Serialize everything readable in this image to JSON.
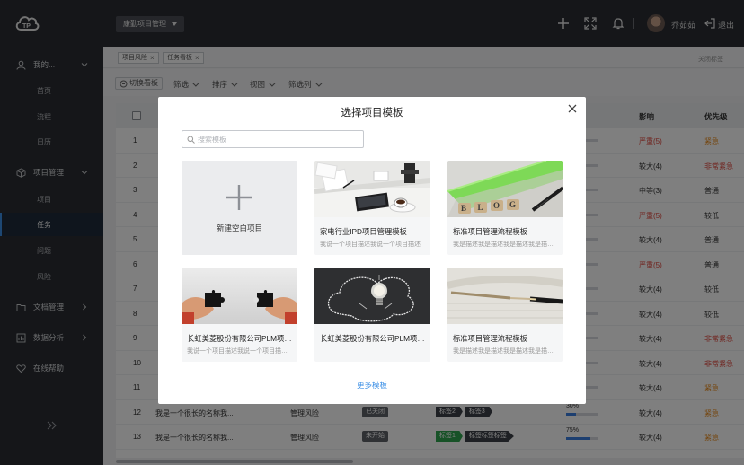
{
  "header": {
    "project_select": "康勤项目管理",
    "user_name": "乔茹茹",
    "logout": "退出"
  },
  "sidebar": {
    "groups": [
      {
        "label": "我的...",
        "icon": "user-icon",
        "items": [
          "首页",
          "流程",
          "日历"
        ]
      },
      {
        "label": "项目管理",
        "icon": "cube-icon",
        "items": [
          "项目",
          "任务",
          "问题",
          "风险"
        ]
      },
      {
        "label": "文档管理",
        "icon": "folder-icon",
        "items": []
      },
      {
        "label": "数据分析",
        "icon": "chart-icon",
        "items": []
      },
      {
        "label": "在线帮助",
        "icon": "heart-icon",
        "items": []
      }
    ],
    "active_item": "任务"
  },
  "tabs": [
    {
      "label": "项目风险"
    },
    {
      "label": "任务看板"
    }
  ],
  "close_tabs": "关闭标签",
  "toolbar": {
    "switch_board": "切换看板",
    "filters": [
      "筛选",
      "排序",
      "视图",
      "筛选列"
    ]
  },
  "table": {
    "columns": {
      "impact": "影响",
      "priority": "优先级"
    },
    "rows": [
      {
        "num": "1",
        "name": "",
        "type": "",
        "status": "",
        "tags": [],
        "progress": "",
        "progress_value": 0,
        "impact": "严重(5)",
        "impact_color": "#e0463c",
        "priority": "紧急",
        "priority_color": "#e88a1a"
      },
      {
        "num": "2",
        "name": "",
        "type": "",
        "status": "",
        "tags": [],
        "progress": "",
        "progress_value": 0,
        "impact": "较大(4)",
        "impact_color": "#333333",
        "priority": "非常紧急",
        "priority_color": "#e0463c"
      },
      {
        "num": "3",
        "name": "",
        "type": "",
        "status": "",
        "tags": [],
        "progress": "",
        "progress_value": 0,
        "impact": "中等(3)",
        "impact_color": "#333333",
        "priority": "普通",
        "priority_color": "#333333"
      },
      {
        "num": "4",
        "name": "",
        "type": "",
        "status": "",
        "tags": [],
        "progress": "",
        "progress_value": 0,
        "impact": "严重(5)",
        "impact_color": "#e0463c",
        "priority": "较低",
        "priority_color": "#333333"
      },
      {
        "num": "5",
        "name": "",
        "type": "",
        "status": "",
        "tags": [],
        "progress": "",
        "progress_value": 0,
        "impact": "较大(4)",
        "impact_color": "#333333",
        "priority": "普通",
        "priority_color": "#333333"
      },
      {
        "num": "6",
        "name": "",
        "type": "",
        "status": "",
        "tags": [],
        "progress": "",
        "progress_value": 0,
        "impact": "严重(5)",
        "impact_color": "#e0463c",
        "priority": "普通",
        "priority_color": "#333333"
      },
      {
        "num": "7",
        "name": "",
        "type": "",
        "status": "",
        "tags": [],
        "progress": "",
        "progress_value": 0,
        "impact": "较大(4)",
        "impact_color": "#333333",
        "priority": "较低",
        "priority_color": "#333333"
      },
      {
        "num": "8",
        "name": "",
        "type": "",
        "status": "",
        "tags": [],
        "progress": "",
        "progress_value": 0,
        "impact": "较大(4)",
        "impact_color": "#333333",
        "priority": "较低",
        "priority_color": "#333333"
      },
      {
        "num": "9",
        "name": "",
        "type": "",
        "status": "",
        "tags": [],
        "progress": "",
        "progress_value": 0,
        "impact": "较大(4)",
        "impact_color": "#333333",
        "priority": "非常紧急",
        "priority_color": "#e0463c"
      },
      {
        "num": "10",
        "name": "",
        "type": "",
        "status": "",
        "tags": [],
        "progress": "",
        "progress_value": 0,
        "impact": "较大(4)",
        "impact_color": "#333333",
        "priority": "非常紧急",
        "priority_color": "#e0463c"
      },
      {
        "num": "11",
        "name": "",
        "type": "",
        "status": "",
        "tags": [],
        "progress": "",
        "progress_value": 0,
        "impact": "较大(4)",
        "impact_color": "#333333",
        "priority": "紧急",
        "priority_color": "#e88a1a"
      },
      {
        "num": "12",
        "name": "我是一个很长的名称我...",
        "type": "管理风险",
        "status": "已关闭",
        "tags": [
          {
            "label": "标签2",
            "color": "#3d4148"
          },
          {
            "label": "标签3",
            "color": "#3d4148"
          }
        ],
        "progress": "30%",
        "progress_value": 0.3,
        "impact": "较大(4)",
        "impact_color": "#333333",
        "priority": "紧急",
        "priority_color": "#e88a1a"
      },
      {
        "num": "13",
        "name": "我是一个很长的名称我...",
        "type": "管理风险",
        "status": "未开始",
        "tags": [
          {
            "label": "标签1",
            "color": "#2ea44f"
          },
          {
            "label": "标签标签标签",
            "color": "#3d4148"
          }
        ],
        "progress": "75%",
        "progress_value": 0.75,
        "impact": "较大(4)",
        "impact_color": "#333333",
        "priority": "紧急",
        "priority_color": "#e88a1a"
      }
    ]
  },
  "modal": {
    "title": "选择项目模板",
    "search_placeholder": "搜索模板",
    "new_blank": "新建空白项目",
    "templates": [
      {
        "title": "家电行业IPD项目管理模板",
        "desc": "我说一个项目描述我说一个项目描述",
        "image": "desk-photo"
      },
      {
        "title": "标准项目管理流程模板",
        "desc": "我是描述我是描述我是描述我是描述我是描述",
        "image": "blog-blocks-photo"
      },
      {
        "title": "长虹美菱股份有限公司PLM项目管理",
        "desc": "我说一个项目描述我说一个项目描述我说一个项目描述",
        "image": "puzzle-photo"
      },
      {
        "title": "长虹美菱股份有限公司PLM项目管理",
        "desc": "",
        "image": "lightbulb-photo"
      },
      {
        "title": "标准项目管理流程模板",
        "desc": "我是描述我是描述我是描述我是描述我是描述",
        "image": "pen-photo"
      }
    ],
    "more": "更多模板"
  }
}
